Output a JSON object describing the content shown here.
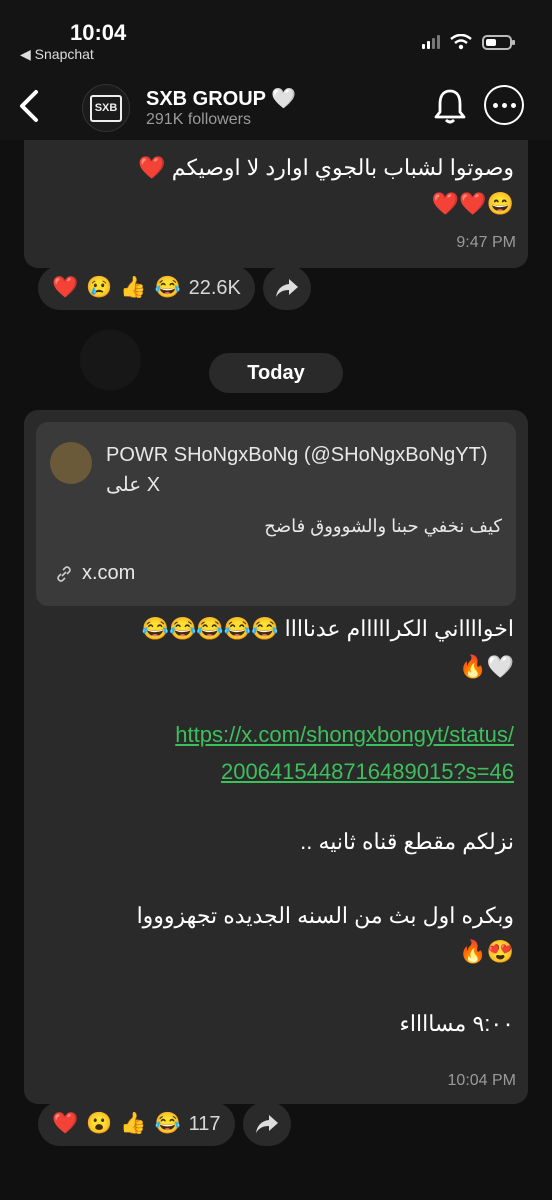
{
  "status_bar": {
    "time": "10:04",
    "back_app": "◀ Snapchat"
  },
  "header": {
    "title": "SXB GROUP 🤍",
    "followers": "291K followers",
    "avatar_text": "SXB"
  },
  "message1": {
    "lines": [
      "وصوتوا لشباب بالجوي اوارد لا اوصيكم ❤️",
      "😄❤️❤️"
    ],
    "time": "9:47 PM",
    "reactions": [
      "❤️",
      "😢",
      "👍",
      "😂"
    ],
    "reaction_count": "22.6K"
  },
  "date_divider": "Today",
  "message2": {
    "preview": {
      "title": "POWR SHoNgxBoNg (@SHoNgxBoNgYT) على X",
      "description": "كيف نخفي حبنا والشوووق فاضح",
      "link": "x.com"
    },
    "line1": "اخوااااني الكرااااام عدناااا 😂😂😂😂😂",
    "line2": "🤍🔥",
    "url_line1": "https://x.com/shongxbongyt/status/",
    "url_line2": "2006415448716489015?s=46",
    "line3": "نزلكم مقطع قناه ثانيه ..",
    "line4": "وبكره اول بث من السنه الجديده تجهزوووا",
    "line5": "😍🔥",
    "line6": "٩:٠٠ مسااااء",
    "time": "10:04 PM",
    "reactions": [
      "❤️",
      "😮",
      "👍",
      "😂"
    ],
    "reaction_count": "117"
  },
  "colors": {
    "bubble": "#2a2a2a",
    "link": "#3dbf5c",
    "background": "#101010"
  }
}
